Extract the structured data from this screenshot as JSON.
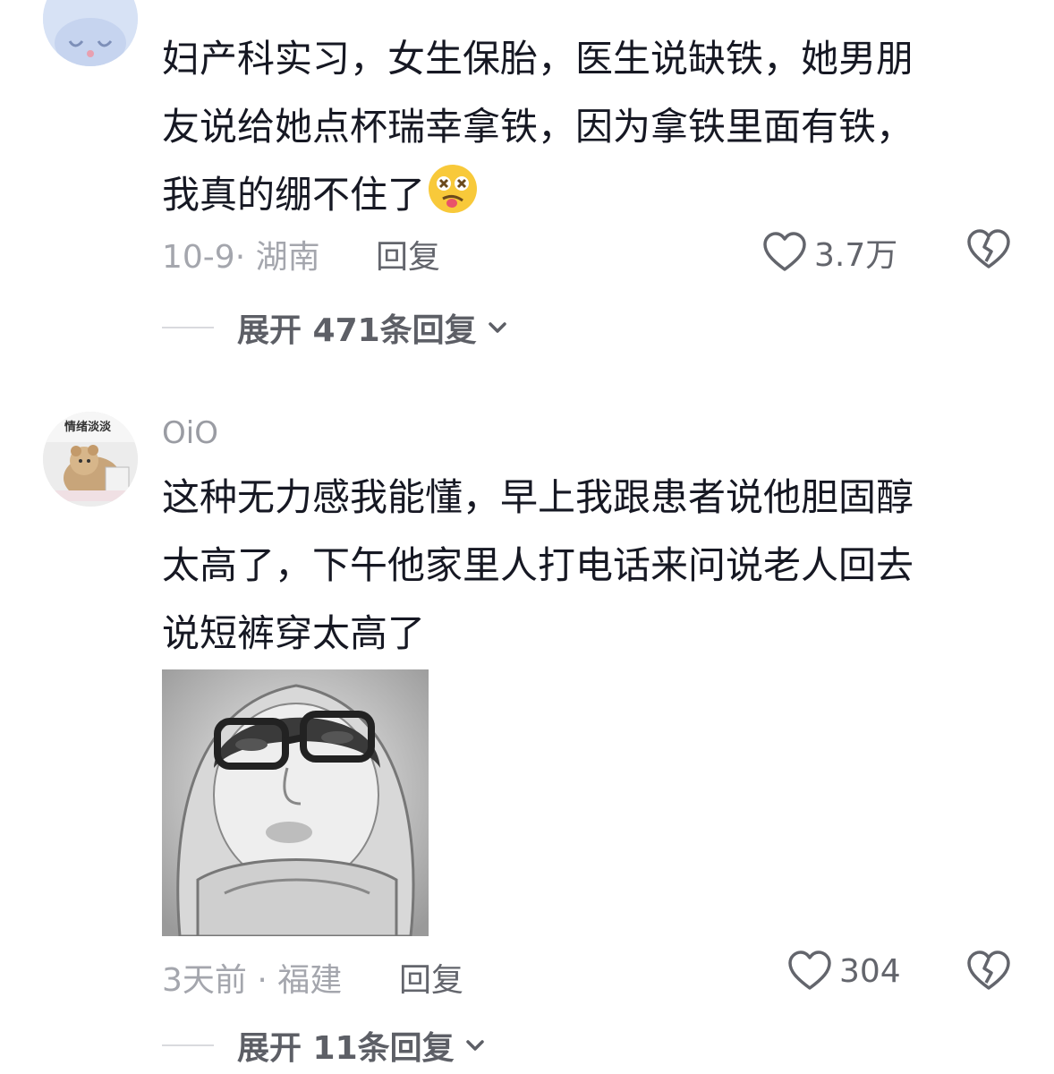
{
  "comments": [
    {
      "text_lines": [
        "妇产科实习，女生保胎，医生说缺铁，她男朋",
        "友说给她点杯瑞幸拿铁，因为拿铁里面有铁，",
        "我真的绷不住了"
      ],
      "date_location": "10-9· 湖南",
      "reply_label": "回复",
      "likes": "3.7万",
      "expand_replies": "展开 471条回复"
    },
    {
      "username": "OiO",
      "avatar_text": "情绪淡淡",
      "text_lines": [
        "这种无力感我能懂，早上我跟患者说他胆固醇",
        "太高了，下午他家里人打电话来问说老人回去",
        "说短裤穿太高了"
      ],
      "date_location": "3天前 · 福建",
      "reply_label": "回复",
      "likes": "304",
      "expand_replies": "展开 11条回复"
    }
  ],
  "icons": {
    "like": "heart-outline-icon",
    "dislike": "broken-heart-icon",
    "expand": "chevron-down-icon",
    "emoji": "dizzy-face-emoji"
  },
  "colors": {
    "text": "#161823",
    "meta": "#a4a6ad",
    "action": "#63656c",
    "username": "#9a9ca3"
  }
}
